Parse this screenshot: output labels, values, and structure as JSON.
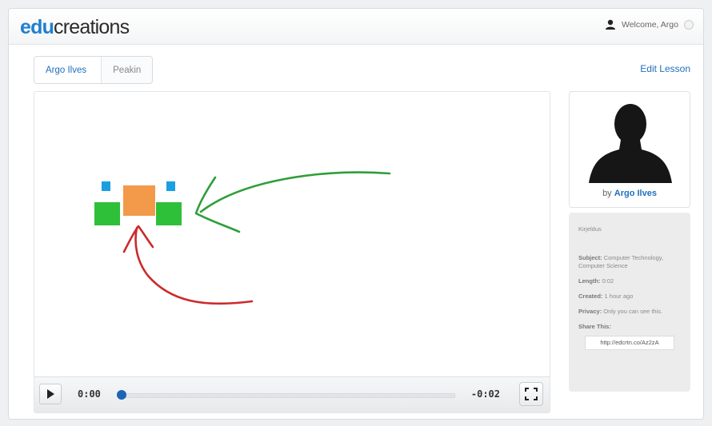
{
  "header": {
    "logo_part1": "edu",
    "logo_part2": "creations",
    "welcome": "Welcome, Argo"
  },
  "breadcrumb": {
    "items": [
      "Argo Ilves",
      "Peakin"
    ]
  },
  "actions": {
    "edit_lesson": "Edit Lesson"
  },
  "player": {
    "current_time": "0:00",
    "remaining_time": "-0:02",
    "progress": 0
  },
  "author": {
    "by": "by",
    "name": "Argo Ilves"
  },
  "info": {
    "description": "Kirjeldus",
    "subject_label": "Subject:",
    "subject_value": "Computer Technology, Computer Science",
    "length_label": "Length:",
    "length_value": "0:02",
    "created_label": "Created:",
    "created_value": "1 hour ago",
    "privacy_label": "Privacy:",
    "privacy_value": "Only you can see this.",
    "share_label": "Share This:",
    "share_url": "http://edcrtn.co/Az2zA"
  },
  "colors": {
    "accent": "#1f7fcf",
    "link": "#1f6fbf",
    "green_stroke": "#2e9e3a",
    "red_stroke": "#cc2a2a",
    "orange": "#f39a4a",
    "green_block": "#2fc03a",
    "blue_block": "#1a9fe0"
  }
}
